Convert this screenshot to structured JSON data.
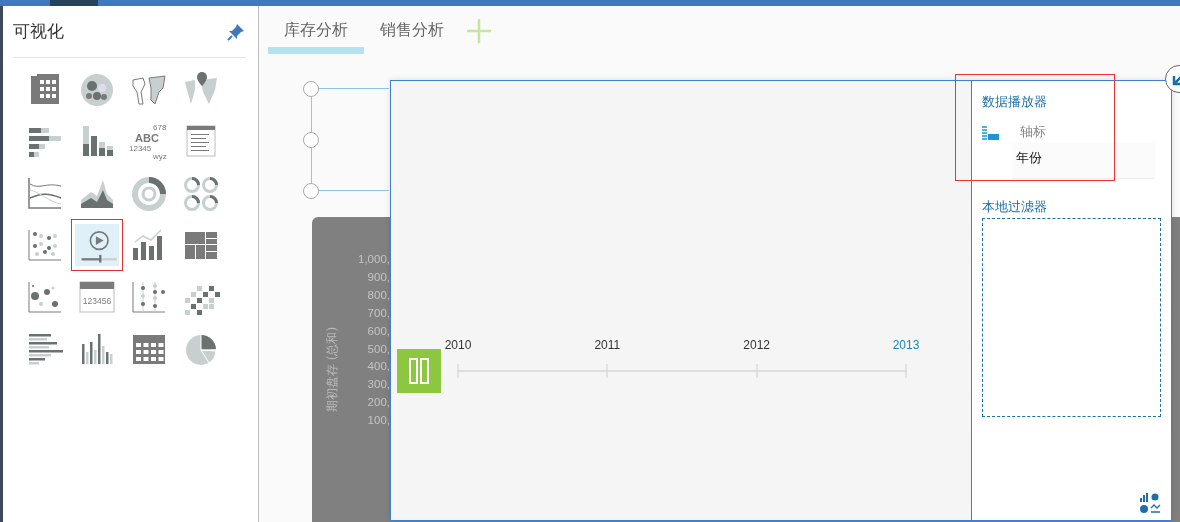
{
  "sidebar": {
    "title": "可视化",
    "items": [
      {
        "kind": "table",
        "selected": false
      },
      {
        "kind": "bubble",
        "selected": false
      },
      {
        "kind": "map",
        "selected": false
      },
      {
        "kind": "geomap",
        "selected": false
      },
      {
        "kind": "hbar",
        "selected": false
      },
      {
        "kind": "column",
        "selected": false
      },
      {
        "kind": "tagcloud",
        "selected": false
      },
      {
        "kind": "text",
        "selected": false
      },
      {
        "kind": "line",
        "selected": false
      },
      {
        "kind": "area",
        "selected": false
      },
      {
        "kind": "radial",
        "selected": false
      },
      {
        "kind": "donut",
        "selected": false
      },
      {
        "kind": "scatter",
        "selected": false
      },
      {
        "kind": "player",
        "selected": true
      },
      {
        "kind": "combo",
        "selected": false
      },
      {
        "kind": "treemap",
        "selected": false
      },
      {
        "kind": "bubblescatter",
        "selected": false
      },
      {
        "kind": "numeric",
        "selected": false
      },
      {
        "kind": "dotplot",
        "selected": false
      },
      {
        "kind": "heatmap",
        "selected": false
      },
      {
        "kind": "barlist",
        "selected": false
      },
      {
        "kind": "columns",
        "selected": false
      },
      {
        "kind": "grid",
        "selected": false
      },
      {
        "kind": "pie",
        "selected": false
      }
    ],
    "tagcloud_words": [
      "678",
      "ABC",
      "12345",
      "wyz"
    ],
    "numeric_text": "123456"
  },
  "tabs": [
    {
      "label": "库存分析",
      "selected": true
    },
    {
      "label": "销售分析",
      "selected": false
    }
  ],
  "chart_panel": {
    "axis_title": "期初盘存 (总和)",
    "axis_labels": [
      "1,000,",
      "900,",
      "800,",
      "700,",
      "600,",
      "500,",
      "400,",
      "300,",
      "200,",
      "100,"
    ]
  },
  "player": {
    "playing": true,
    "years": [
      {
        "label": "2010",
        "selected": false
      },
      {
        "label": "2011",
        "selected": false
      },
      {
        "label": "2012",
        "selected": false
      },
      {
        "label": "2013",
        "selected": true
      }
    ],
    "panel": {
      "title": "数据播放器",
      "highlighted": true,
      "field_label": "轴标",
      "field_value": "年份",
      "filter_title": "本地过滤器"
    }
  }
}
